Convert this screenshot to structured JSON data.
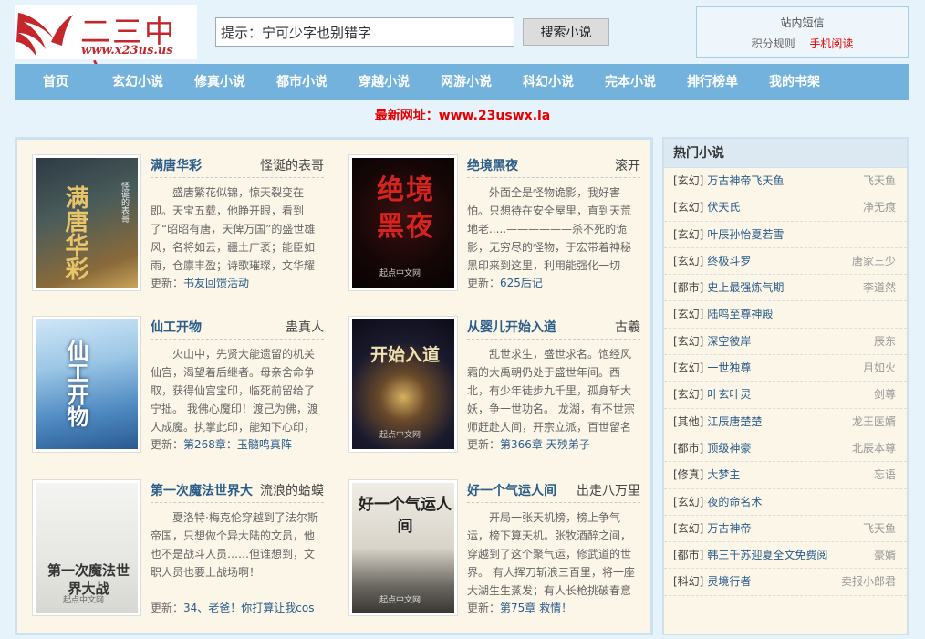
{
  "header": {
    "site_name": "二三中文",
    "site_domain": "www.x23us.us",
    "search": {
      "value": "提示：宁可少字也别错字",
      "button": "搜索小说"
    },
    "user_links": {
      "messages": "站内短信",
      "points_rules": "积分规则",
      "mobile": "手机阅读"
    }
  },
  "nav": [
    "首页",
    "玄幻小说",
    "修真小说",
    "都市小说",
    "穿越小说",
    "网游小说",
    "科幻小说",
    "完本小说",
    "排行榜单",
    "我的书架"
  ],
  "notice": "最新网址：www.23uswx.la",
  "update_prefix": "更新：",
  "books": [
    {
      "title": "满唐华彩",
      "author": "怪诞的表哥",
      "desc": "盛唐繁花似锦，惊天裂变在即。天宝五载，他睁开眼，看到了“昭昭有唐，天俾万国”的盛世雄风，名将如云，疆土广袤；能臣如雨，仓廪丰盈；诗歌璀璨，文华耀目",
      "update": "书友回馈活动",
      "cover_text": "满唐华彩",
      "cover_sub": "怪诞的表哥"
    },
    {
      "title": "绝境黑夜",
      "author": "滚开",
      "desc": "外面全是怪物诡影，我好害怕。只想待在安全屋里，直到天荒地老.....——————杀不死的诡影，无穷尽的怪物，于宏带着神秘黑印来到这里，利用能强化一切",
      "update": "625后记",
      "cover_text": "绝境黑夜",
      "cover_sub": "起点中文网"
    },
    {
      "title": "仙工开物",
      "author": "蛊真人",
      "desc": "火山中，先贤大能遗留的机关仙宫，渴望着后继者。母亲舍命争取，获得仙宫宝印，临死前留给了宁拙。 我佛心魔印！渡己为佛，渡人成魔。执掌此印，能知下心印，",
      "update": "第268章：玉髓鸣真阵",
      "cover_text": "仙工开物",
      "cover_sub": ""
    },
    {
      "title": "从婴儿开始入道",
      "author": "古羲",
      "desc": "乱世求生，盛世求名。饱经风霜的大禹朝仍处于盛世年间。西北，有少年徒步九千里，孤身斩大妖，争一世功名。 龙湖，有不世宗师赶赴人间，开宗立派，百世留名",
      "update": "第366章 天殃弟子",
      "cover_text": "开始入道",
      "cover_sub": "起点中文网"
    },
    {
      "title": "第一次魔法世界大",
      "author": "流浪的蛤蟆",
      "desc": "夏洛特·梅克伦穿越到了法尔斯帝国，只想做个异大陆的文员，他也不是战斗人员……但谁想到，文职人员也要上战场啊！",
      "update": "34、老爸！你打算让我cos",
      "cover_text": "第一次魔法世界大战",
      "cover_sub": "起点中文网"
    },
    {
      "title": "好一个气运人间",
      "author": "出走八万里",
      "desc": "开局一张天机榜，榜上争气运，榜下算天机。张牧酒醉之间，穿越到了这个聚气运，修武道的世界。 有人挥刀斩浪三百里，将一座大湖生生蒸发；有人长枪挑破春意",
      "update": "第75章 救情！",
      "cover_text": "好一个气运人间",
      "cover_sub": "起点中文网"
    }
  ],
  "sidebar": {
    "title": "热门小说",
    "items": [
      {
        "cat": "[玄幻]",
        "name": "万古神帝飞天鱼",
        "author": "飞天鱼"
      },
      {
        "cat": "[玄幻]",
        "name": "伏天氏",
        "author": "净无痕"
      },
      {
        "cat": "[玄幻]",
        "name": "叶辰孙怡夏若雪",
        "author": ""
      },
      {
        "cat": "[玄幻]",
        "name": "终极斗罗",
        "author": "唐家三少"
      },
      {
        "cat": "[都市]",
        "name": "史上最强炼气期",
        "author": "李道然"
      },
      {
        "cat": "[玄幻]",
        "name": "陆鸣至尊神殿",
        "author": ""
      },
      {
        "cat": "[玄幻]",
        "name": "深空彼岸",
        "author": "辰东"
      },
      {
        "cat": "[玄幻]",
        "name": "一世独尊",
        "author": "月如火"
      },
      {
        "cat": "[玄幻]",
        "name": "叶玄叶灵",
        "author": "剑尊"
      },
      {
        "cat": "[其他]",
        "name": "江辰唐楚楚",
        "author": "龙王医婿"
      },
      {
        "cat": "[都市]",
        "name": "顶级神豪",
        "author": "北辰本尊"
      },
      {
        "cat": "[修真]",
        "name": "大梦主",
        "author": "忘语"
      },
      {
        "cat": "[玄幻]",
        "name": "夜的命名术",
        "author": ""
      },
      {
        "cat": "[玄幻]",
        "name": "万古神帝",
        "author": "飞天鱼"
      },
      {
        "cat": "[都市]",
        "name": "韩三千苏迎夏全文免费阅",
        "author": "豪婿"
      },
      {
        "cat": "[科幻]",
        "name": "灵境行者",
        "author": "卖报小郎君"
      }
    ]
  }
}
